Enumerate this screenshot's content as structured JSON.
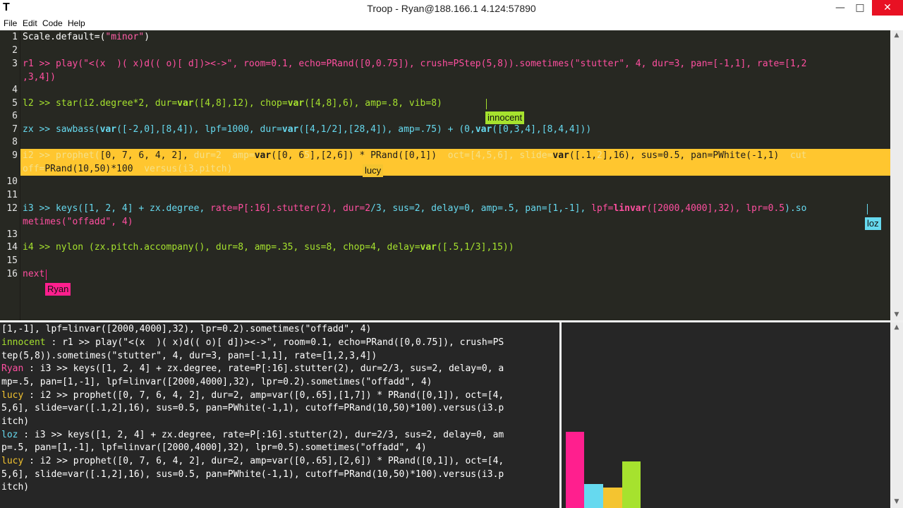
{
  "window": {
    "app_icon": "T",
    "title": "Troop - Ryan@188.166.1  4.124:57890",
    "minimize": "—",
    "maximize": "□",
    "close": "✕"
  },
  "menu": [
    "File",
    "Edit",
    "Code",
    "Help"
  ],
  "editor": {
    "line_numbers": [
      "1",
      "2",
      "3",
      "4",
      "5",
      "6",
      "7",
      "8",
      "9",
      "10",
      "11",
      "12",
      "13",
      "14",
      "15",
      "16"
    ],
    "lines": {
      "l1": [
        {
          "t": "Scale.default=(",
          "c": "#fcfcfc"
        },
        {
          "t": "\"minor\"",
          "c": "#ff5ea7"
        },
        {
          "t": ")",
          "c": "#fcfcfc"
        }
      ],
      "l3a": [
        {
          "t": "r1 >> ",
          "c": "#ff4fa0"
        },
        {
          "t": "play(",
          "c": "#ff4fa0"
        },
        {
          "t": "\"<(x  )( x)d(( o)[ d])><->\"",
          "c": "#ff4fa0"
        },
        {
          "t": ", room=0.1, echo=PRand([0,0.75]), crush=PStep(5,8)).sometimes(",
          "c": "#ff4fa0"
        },
        {
          "t": "\"stutter\"",
          "c": "#ff4fa0"
        },
        {
          "t": ", 4, dur=3, pan=[-1,1], rate=[1,2",
          "c": "#ff4fa0"
        }
      ],
      "l3b": [
        {
          "t": ",3,4])",
          "c": "#ff4fa0"
        }
      ],
      "l5": [
        {
          "t": "l2 >> star(i2.degree*2, dur=",
          "c": "#a6e22e"
        },
        {
          "t": "var",
          "c": "#a6e22e",
          "b": true
        },
        {
          "t": "([4,8],12), chop=",
          "c": "#a6e22e"
        },
        {
          "t": "var",
          "c": "#a6e22e",
          "b": true
        },
        {
          "t": "([4,8],6), amp=.8, vib=8)",
          "c": "#a6e22e"
        }
      ],
      "l7": [
        {
          "t": "zx >> sawbass(",
          "c": "#66d9ef"
        },
        {
          "t": "var",
          "c": "#66d9ef",
          "b": true
        },
        {
          "t": "([-2,0],[8,4]), lpf=1000, dur=",
          "c": "#66d9ef"
        },
        {
          "t": "var",
          "c": "#66d9ef",
          "b": true
        },
        {
          "t": "([4,1/2],[28,4]), amp=.75) + (0,",
          "c": "#66d9ef"
        },
        {
          "t": "var",
          "c": "#66d9ef",
          "b": true
        },
        {
          "t": "([0,3,4],[8,4,4]))",
          "c": "#66d9ef"
        }
      ],
      "l9a": [
        {
          "t": "i2 >> prophet(",
          "c": "#f4e08a"
        },
        {
          "t": "[0, 7, 6, 4, 2], ",
          "c": "#1c1c1c"
        },
        {
          "t": "dur=2  amp=",
          "c": "#f4e08a"
        },
        {
          "t": "var",
          "c": "#1c1c1c",
          "b": true
        },
        {
          "t": "([0, 6",
          "c": "#1c1c1c"
        },
        {
          "t": "5",
          "c": "#f4e08a"
        },
        {
          "t": "],[2,6]) * PRand([0,1])  ",
          "c": "#1c1c1c"
        },
        {
          "t": "oct=[4,5,6], slide=",
          "c": "#f4e08a"
        },
        {
          "t": "var",
          "c": "#1c1c1c",
          "b": true
        },
        {
          "t": "([.1,",
          "c": "#1c1c1c"
        },
        {
          "t": "2",
          "c": "#f4e08a"
        },
        {
          "t": "],16), sus=0.5, pan=PWhite(-1,1)  ",
          "c": "#1c1c1c"
        },
        {
          "t": "cut",
          "c": "#f4e08a"
        }
      ],
      "l9b": [
        {
          "t": "off=",
          "c": "#f4e08a"
        },
        {
          "t": "PRand(10,50)*100  ",
          "c": "#1c1c1c"
        },
        {
          "t": "versus(i3.pitch)",
          "c": "#f4e08a"
        }
      ],
      "l12a": [
        {
          "t": "i3 >> keys([1, 2, 4] + zx.degree, ",
          "c": "#66d9ef"
        },
        {
          "t": "rate=P[:16].stutter(2), dur=2",
          "c": "#ff4fa0"
        },
        {
          "t": "/3, sus=2, delay=0, amp=.5, pan=[1,-1], ",
          "c": "#66d9ef"
        },
        {
          "t": "lpf=",
          "c": "#ff4fa0"
        },
        {
          "t": "linvar",
          "c": "#ff4fa0",
          "b": true
        },
        {
          "t": "([2000,4000],32), lpr=0.5",
          "c": "#ff4fa0"
        },
        {
          "t": ").so",
          "c": "#66d9ef"
        }
      ],
      "l12b": [
        {
          "t": "metimes(\"offadd\", 4)",
          "c": "#ff4fa0"
        }
      ],
      "l14": [
        {
          "t": "i4 >> nylon (zx.pitch.accompany(), dur=8, amp=.35, sus=8, chop=4, delay=",
          "c": "#a6e22e"
        },
        {
          "t": "var",
          "c": "#a6e22e",
          "b": true
        },
        {
          "t": "([.5,1/3],15))",
          "c": "#a6e22e"
        }
      ],
      "l16": [
        {
          "t": "next",
          "c": "#ff4fa0"
        }
      ]
    },
    "tags": {
      "innocent": "innocent",
      "lucy": "lucy",
      "loz": "loz",
      "ryan": "Ryan"
    }
  },
  "console": {
    "lines": [
      {
        "t": "[1,-1], lpf=linvar([2000,4000],32), lpr=0.2).sometimes(\"offadd\", 4)",
        "c": "#ffffff"
      },
      {
        "t": "innocent : r1 >> play(\"<(x  )( x)d(( o)[ d])><->\", room=0.1, echo=PRand([0,0.75]), crush=PS",
        "c": "#a6e22e",
        "p": "innocent"
      },
      {
        "t": "tep(5,8)).sometimes(\"stutter\", 4, dur=3, pan=[-1,1], rate=[1,2,3,4])",
        "c": "#ffffff"
      },
      {
        "t": "Ryan : i3 >> keys([1, 2, 4] + zx.degree, rate=P[:16].stutter(2), dur=2/3, sus=2, delay=0, a",
        "c": "#ff4fa0",
        "p": "Ryan"
      },
      {
        "t": "mp=.5, pan=[1,-1], lpf=linvar([2000,4000],32), lpr=0.2).sometimes(\"offadd\", 4)",
        "c": "#ffffff"
      },
      {
        "t": "lucy : i2 >> prophet([0, 7, 6, 4, 2], dur=2, amp=var([0,.65],[1,7]) * PRand([0,1]), oct=[4,",
        "c": "#f4c430",
        "p": "lucy"
      },
      {
        "t": "5,6], slide=var([.1,2],16), sus=0.5, pan=PWhite(-1,1), cutoff=PRand(10,50)*100).versus(i3.p",
        "c": "#ffffff"
      },
      {
        "t": "itch)",
        "c": "#ffffff"
      },
      {
        "t": "loz : i3 >> keys([1, 2, 4] + zx.degree, rate=P[:16].stutter(2), dur=2/3, sus=2, delay=0, am",
        "c": "#66d9ef",
        "p": "loz"
      },
      {
        "t": "p=.5, pan=[1,-1], lpf=linvar([2000,4000],32), lpr=0.5).sometimes(\"offadd\", 4)",
        "c": "#ffffff"
      },
      {
        "t": "lucy : i2 >> prophet([0, 7, 6, 4, 2], dur=2, amp=var([0,.65],[2,6]) * PRand([0,1]), oct=[4,",
        "c": "#f4c430",
        "p": "lucy"
      },
      {
        "t": "5,6], slide=var([.1,2],16), sus=0.5, pan=PWhite(-1,1), cutoff=PRand(10,50)*100).versus(i3.p",
        "c": "#ffffff"
      },
      {
        "t": "itch)",
        "c": "#ffffff"
      }
    ]
  },
  "meter": {
    "bars": [
      {
        "user": "Ryan",
        "color": "#ff1f8e",
        "level": 0.41
      },
      {
        "user": "loz",
        "color": "#66d9ef",
        "level": 0.13
      },
      {
        "user": "lucy",
        "color": "#f4c430",
        "level": 0.11
      },
      {
        "user": "innocent",
        "color": "#a6e22e",
        "level": 0.25
      }
    ]
  },
  "colors": {
    "editor_bg": "#272822",
    "console_bg": "#262626",
    "highlight": "#ffc62f",
    "innocent": "#a6e22e",
    "lucy": "#f4c430",
    "loz": "#66d9ef",
    "ryan": "#ff1f8e"
  }
}
